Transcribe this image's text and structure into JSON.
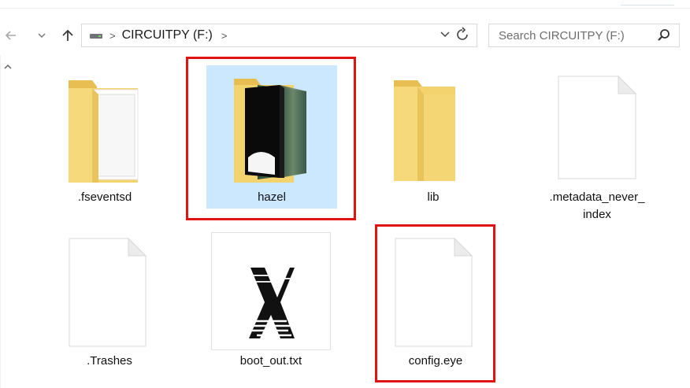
{
  "window": {
    "location": "CIRCUITPY (F:)"
  },
  "nav": {
    "back_icon": "arrow-left-icon",
    "forward_icon": "chevron-down-icon",
    "up_icon": "arrow-up-icon"
  },
  "address": {
    "crumb": "CIRCUITPY (F:)",
    "separator": ">",
    "dropdown_icon": "chevron-down-icon",
    "refresh_icon": "refresh-icon"
  },
  "search": {
    "placeholder": "Search CIRCUITPY (F:)",
    "icon": "search-icon"
  },
  "files": [
    {
      "name": ".fseventsd",
      "type": "folder"
    },
    {
      "name": "hazel",
      "type": "folder",
      "selected": true,
      "highlighted": true
    },
    {
      "name": "lib",
      "type": "folder"
    },
    {
      "name": ".metadata_never_",
      "name2": "index",
      "type": "file"
    },
    {
      "name": ".Trashes",
      "type": "file"
    },
    {
      "name": "boot_out.txt",
      "type": "file"
    },
    {
      "name": "config.eye",
      "type": "file",
      "highlighted": true
    }
  ],
  "colors": {
    "selection": "#cce8ff",
    "highlight": "#e11414",
    "folder": "#f3d36e"
  }
}
